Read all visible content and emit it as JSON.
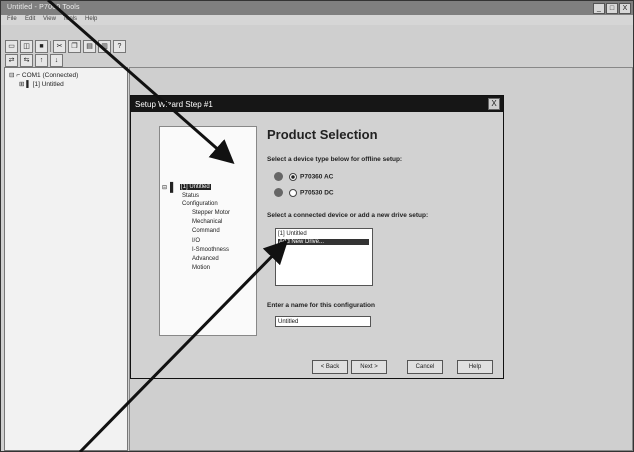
{
  "window": {
    "title": "Untitled - P7000 Tools",
    "min_label": "_",
    "max_label": "□",
    "close_label": "X"
  },
  "menubar": {
    "items": [
      "File",
      "Edit",
      "View",
      "Tools",
      "Help"
    ]
  },
  "toolbar1": {
    "icons": [
      "new-file-icon",
      "open-folder-icon",
      "save-icon",
      "cut-icon",
      "copy-icon",
      "paste-icon",
      "print-icon",
      "help-icon"
    ]
  },
  "toolbar2": {
    "icons": [
      "connect-icon",
      "disconnect-icon",
      "upload-icon",
      "download-icon"
    ]
  },
  "tree": {
    "items": [
      {
        "label": "COM1 (Connected)"
      },
      {
        "label": "[1] Untitled"
      }
    ]
  },
  "dialog": {
    "title": "Setup Wizard Step #1",
    "close": "X",
    "page_title": "Product Selection",
    "device_type_label": "Select a device type below for offline setup:",
    "device_types": [
      "P70360 AC",
      "P70530 DC"
    ],
    "connected_label": "Select a connected device or add a new drive setup:",
    "connected_list": [
      "[1] Untitled",
      "Add New Drive..."
    ],
    "name_label": "Enter a name for this configuration",
    "name_value": "Untitled",
    "nav": [
      {
        "label": "[1] Untitled"
      },
      {
        "label": "Status"
      },
      {
        "label": "Configuration"
      },
      {
        "label": "Stepper Motor"
      },
      {
        "label": "Mechanical"
      },
      {
        "label": "Command"
      },
      {
        "label": "I/O"
      },
      {
        "label": "I-Smoothness"
      },
      {
        "label": "Advanced"
      },
      {
        "label": "Motion"
      }
    ],
    "buttons": {
      "back": "< Back",
      "next": "Next >",
      "cancel": "Cancel",
      "help": "Help"
    }
  },
  "colors": {
    "dialog_title_bar": "#161616",
    "selection": "#333333",
    "arrow": "#111111"
  }
}
